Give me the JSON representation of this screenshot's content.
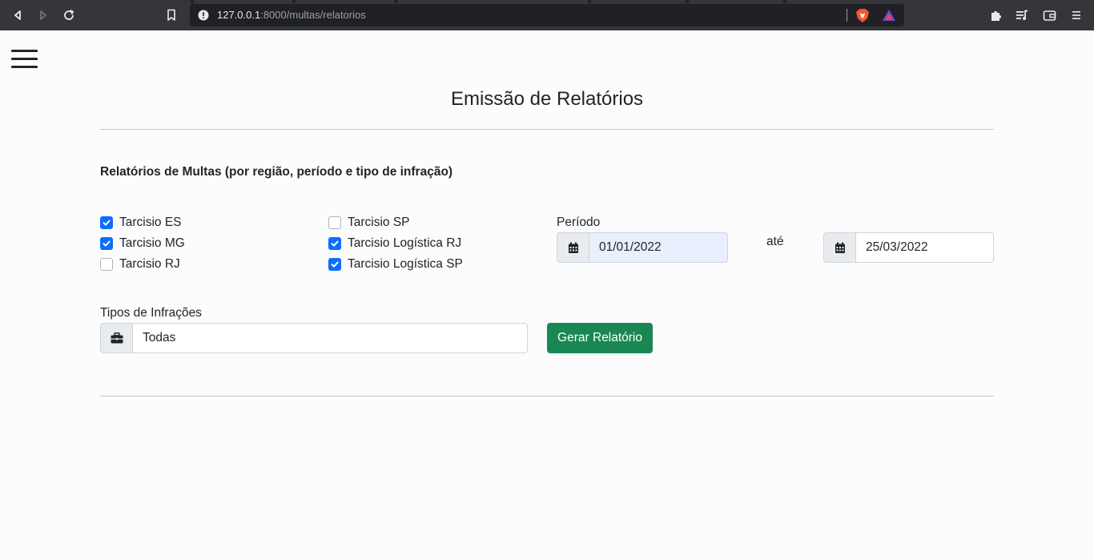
{
  "browser": {
    "url_host": "127.0.0.1",
    "url_rest": ":8000/multas/relatorios"
  },
  "page": {
    "title": "Emissão de Relatórios",
    "section_title": "Relatórios de Multas (por região, período e tipo de infração)"
  },
  "regions": [
    {
      "label": "Tarcisio ES",
      "checked": true
    },
    {
      "label": "Tarcisio MG",
      "checked": true
    },
    {
      "label": "Tarcisio RJ",
      "checked": false
    },
    {
      "label": "Tarcisio SP",
      "checked": false
    },
    {
      "label": "Tarcisio Logística RJ",
      "checked": true
    },
    {
      "label": "Tarcisio Logística SP",
      "checked": true
    }
  ],
  "period": {
    "label": "Período",
    "start": "01/01/2022",
    "separator": "até",
    "end": "25/03/2022"
  },
  "infractions": {
    "label": "Tipos de Infrações",
    "value": "Todas"
  },
  "actions": {
    "generate_label": "Gerar Relatório"
  },
  "colors": {
    "checkbox_on": "#0d6efd",
    "button": "#198754"
  },
  "icons": {
    "menu": "hamburger-icon",
    "calendar": "calendar-icon",
    "briefcase": "briefcase-icon"
  }
}
